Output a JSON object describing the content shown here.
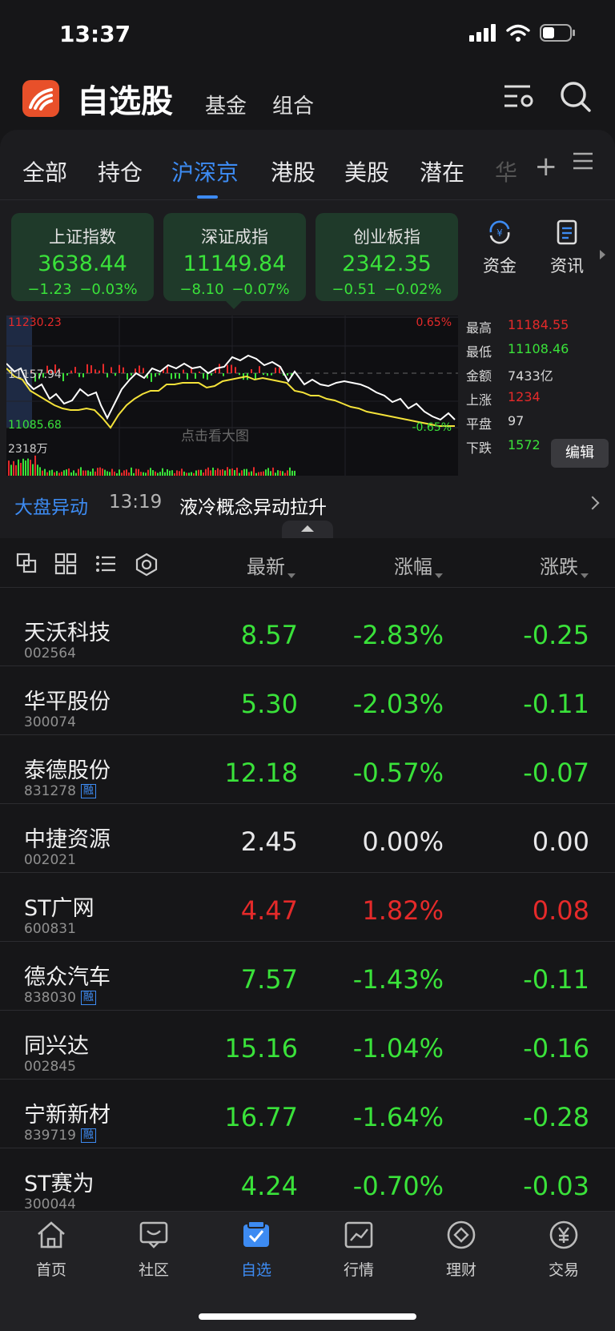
{
  "status": {
    "time": "13:37"
  },
  "app": {
    "title": "自选股",
    "tab_fund": "基金",
    "tab_combo": "组合"
  },
  "tabs": [
    "全部",
    "持仓",
    "沪深京",
    "港股",
    "美股",
    "潜在",
    "华"
  ],
  "indices": [
    {
      "name": "上证指数",
      "value": "3638.44",
      "change": "−1.23",
      "pct": "−0.03%"
    },
    {
      "name": "深证成指",
      "value": "11149.84",
      "change": "−8.10",
      "pct": "−0.07%"
    },
    {
      "name": "创业板指",
      "value": "2342.35",
      "change": "−0.51",
      "pct": "−0.02%"
    }
  ],
  "shortcuts": {
    "funds": "资金",
    "news": "资讯"
  },
  "chart": {
    "top_value": "11230.23",
    "mid_value": "11157.94",
    "bottom_value": "11085.68",
    "top_pct": "0.65%",
    "bottom_pct": "-0.65%",
    "volume_label": "2318万",
    "overlay": "点击看大图"
  },
  "stats": [
    {
      "key": "最高",
      "value": "11184.55",
      "color": "#e52a2a"
    },
    {
      "key": "最低",
      "value": "11108.46",
      "color": "#3ae23a"
    },
    {
      "key": "金额",
      "value": "7433亿",
      "color": "#d8d8d8"
    },
    {
      "key": "上涨",
      "value": "1234",
      "color": "#e52a2a"
    },
    {
      "key": "平盘",
      "value": "97",
      "color": "#d8d8d8"
    },
    {
      "key": "下跌",
      "value": "1572",
      "color": "#3ae23a"
    }
  ],
  "edit_label": "编辑",
  "news": {
    "tag": "大盘异动",
    "time": "13:19",
    "text": "液冷概念异动拉升"
  },
  "columns": {
    "latest": "最新",
    "pct": "涨幅",
    "chg": "涨跌"
  },
  "stocks": [
    {
      "name": "天沃科技",
      "code": "002564",
      "rong": "",
      "price": "8.57",
      "pct": "-2.83%",
      "chg": "-0.25",
      "trend": "down"
    },
    {
      "name": "华平股份",
      "code": "300074",
      "rong": "",
      "price": "5.30",
      "pct": "-2.03%",
      "chg": "-0.11",
      "trend": "down"
    },
    {
      "name": "泰德股份",
      "code": "831278",
      "rong": "融",
      "price": "12.18",
      "pct": "-0.57%",
      "chg": "-0.07",
      "trend": "down"
    },
    {
      "name": "中捷资源",
      "code": "002021",
      "rong": "",
      "price": "2.45",
      "pct": "0.00%",
      "chg": "0.00",
      "trend": "flat"
    },
    {
      "name": "ST广网",
      "code": "600831",
      "rong": "",
      "price": "4.47",
      "pct": "1.82%",
      "chg": "0.08",
      "trend": "up"
    },
    {
      "name": "德众汽车",
      "code": "838030",
      "rong": "融",
      "price": "7.57",
      "pct": "-1.43%",
      "chg": "-0.11",
      "trend": "down"
    },
    {
      "name": "同兴达",
      "code": "002845",
      "rong": "",
      "price": "15.16",
      "pct": "-1.04%",
      "chg": "-0.16",
      "trend": "down"
    },
    {
      "name": "宁新新材",
      "code": "839719",
      "rong": "融",
      "price": "16.77",
      "pct": "-1.64%",
      "chg": "-0.28",
      "trend": "down"
    },
    {
      "name": "ST赛为",
      "code": "300044",
      "rong": "",
      "price": "4.24",
      "pct": "-0.70%",
      "chg": "-0.03",
      "trend": "down"
    }
  ],
  "nav": [
    {
      "label": "首页",
      "icon": "home-icon"
    },
    {
      "label": "社区",
      "icon": "chat-icon"
    },
    {
      "label": "自选",
      "icon": "watchlist-icon"
    },
    {
      "label": "行情",
      "icon": "market-icon"
    },
    {
      "label": "理财",
      "icon": "diamond-icon"
    },
    {
      "label": "交易",
      "icon": "yen-icon"
    }
  ],
  "colors": {
    "up": "#e52a2a",
    "down": "#3ae23a",
    "flat": "#e8e8ea",
    "accent": "#3d8bf2"
  }
}
